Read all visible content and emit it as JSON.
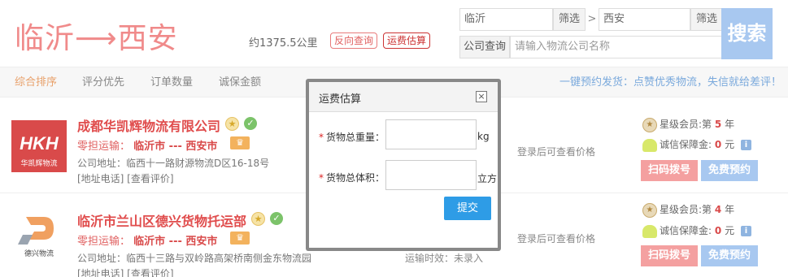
{
  "header": {
    "route_title": "临沂⟶西安",
    "distance": "约1375.5公里",
    "reverse_query": "反向查询",
    "freight_estimate": "运费估算"
  },
  "search": {
    "from_value": "临沂",
    "from_filter": "筛选",
    "separator": ">",
    "to_value": "西安",
    "to_filter": "筛选",
    "company_label": "公司查询",
    "company_placeholder": "请输入物流公司名称",
    "search_button": "搜索"
  },
  "tabs": [
    {
      "label": "综合排序",
      "active": true
    },
    {
      "label": "评分优先"
    },
    {
      "label": "订单数量"
    },
    {
      "label": "诚保金额"
    }
  ],
  "promo": "一键预约发货：点赞优秀物流，失信就给差评！",
  "companies": [
    {
      "logo_text": "华凯辉物流",
      "name": "成都华凯辉物流有限公司",
      "transport_label": "零担运输：",
      "cities": "临沂市 --- 西安市",
      "address": "公司地址：临西十一路财源物流D区16-18号",
      "links": "[地址电话] [查看评价]",
      "price_note": "登录后可查看价格",
      "member_prefix": "星级会员:第",
      "member_years": "5",
      "member_suffix": "年",
      "deposit_prefix": "诚信保障金:",
      "deposit_amount": "0",
      "deposit_unit": "元",
      "scan_button": "扫码拨号",
      "book_button": "免费预约"
    },
    {
      "logo_text": "德兴物流",
      "name": "临沂市兰山区德兴货物托运部",
      "transport_label": "零担运输：",
      "cities": "临沂市 --- 西安市",
      "address": "公司地址：临西十三路与双岭路高架桥南侧金东物流园",
      "links": "[地址电话] [查看评价]",
      "price_note": "登录后可查看价格",
      "time_note": "运输时效：未录入",
      "member_prefix": "星级会员:第",
      "member_years": "4",
      "member_suffix": "年",
      "deposit_prefix": "诚信保障金:",
      "deposit_amount": "0",
      "deposit_unit": "元",
      "scan_button": "扫码拨号",
      "book_button": "免费预约"
    }
  ],
  "dialog": {
    "title": "运费估算",
    "close_glyph": "×",
    "required_mark": "*",
    "weight_label": "货物总重量：",
    "weight_unit": "kg",
    "volume_label": "货物总体积：",
    "volume_unit": "立方",
    "submit": "提交"
  },
  "colors": {
    "brand_red": "#e04c4c",
    "title_pink": "#f08a8a",
    "accent_blue": "#2e9ce6",
    "light_blue": "#a8c8f0"
  }
}
